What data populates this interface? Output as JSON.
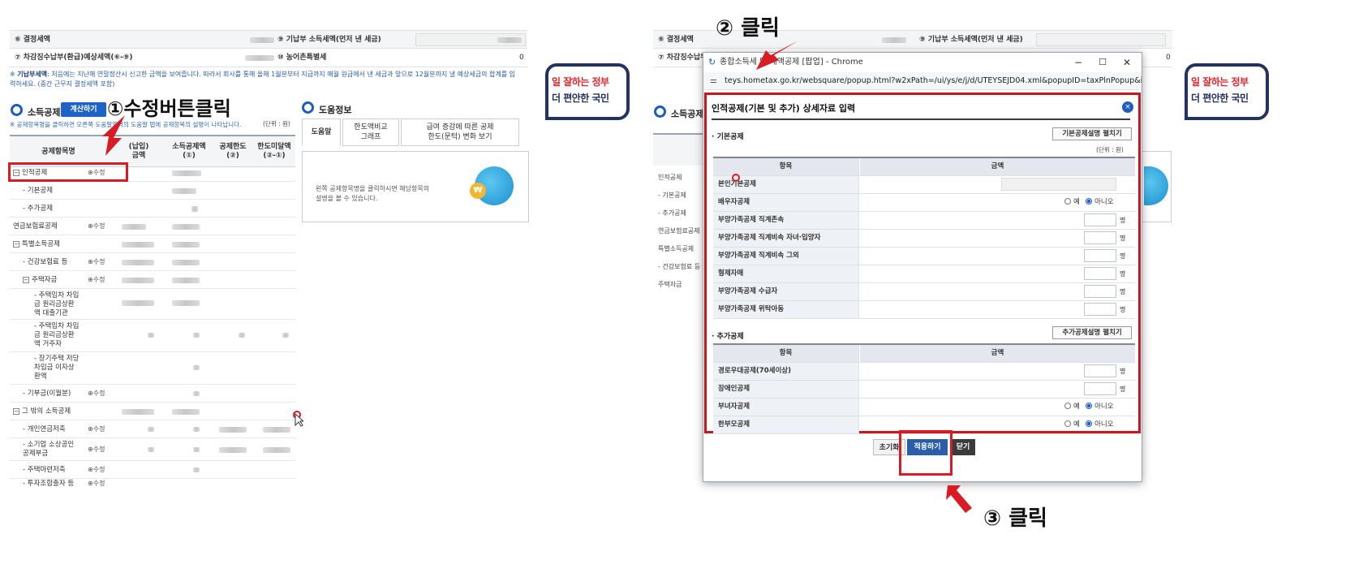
{
  "left_panel": {
    "summary": {
      "row1_left": "⑥ 결정세액",
      "row1_right": "⑨ 기납부 소득세액(먼저 낸 세금)",
      "row2_left": "⑦ 차감징수납부(환급)예상세액(⑥-⑨)",
      "row2_right": "⑩ 농어촌특별세",
      "row2_right_value": "0"
    },
    "note_label": "기납부세액",
    "note_text": ": 처음에는 지난해 연말정산시 신고한 금액을 보여줍니다. 따라서 회사를 통해 올해 1월분부터 지급까지 매월 원급에서 낸 세금과 앞으로 12월분까지 낼 예상세금의 합계를 입력하세요. (중간 근무지 결정세액 포함)",
    "section_title": "소득공제",
    "calc_button": "계산하기",
    "table_note": "※ 공제항목명을 클릭하면 오른쪽 도움말영역의 도움말 탭에 공제항목의 설명이 나타납니다.",
    "unit": "(단위 : 원)",
    "headers": [
      "공제항목명",
      "(납입)\n금액",
      "소득공제액\n(①)",
      "공제한도\n(②)",
      "한도미달액\n(②-①)"
    ],
    "rows": [
      {
        "label": "인적공제",
        "toggle": "−",
        "edit": "⊕수정"
      },
      {
        "label": "- 기본공제",
        "edit": ""
      },
      {
        "label": "- 추가공제",
        "edit": ""
      },
      {
        "label": "연금보험료공제",
        "edit": "⊕수정"
      },
      {
        "label": "특별소득공제",
        "toggle": "−",
        "edit": ""
      },
      {
        "label": "- 건강보험료 등",
        "edit": "⊕수정"
      },
      {
        "label": "주택자금",
        "toggle": "−",
        "edit": "⊕수정"
      },
      {
        "label": "- 주택임차 차입\n금 원리금상환\n액 대출기관",
        "edit": ""
      },
      {
        "label": "- 주택임차 차입\n금 원리금상환\n액 거주자",
        "edit": ""
      },
      {
        "label": "- 장기주택 저당\n차입금 이자상\n환액",
        "edit": ""
      },
      {
        "label": "- 기부금(이월분)",
        "edit": "⊕수정"
      },
      {
        "label": "그 밖의 소득공제",
        "toggle": "−",
        "edit": ""
      },
      {
        "label": "- 개인연금저축",
        "edit": "⊕수정"
      },
      {
        "label": "- 소기업 소상공인\n공제부금",
        "edit": "⊕수정"
      },
      {
        "label": "- 주택마련저축",
        "edit": "⊕수정"
      },
      {
        "label": "- 투자조합출자 등",
        "edit": "⊕수정"
      }
    ]
  },
  "help_panel": {
    "title": "도움정보",
    "tabs": [
      "도움말",
      "한도액비교\n그래프",
      "급여 증감에 따른 공제\n한도(문턱) 변화 보기"
    ],
    "message": "왼쪽 공제항목명을 클릭하시면 해당항목의\n설명을 볼 수 있습니다."
  },
  "gov_logo": {
    "line1": "일 잘하는 정부",
    "line2": "더 편안한 국민"
  },
  "annotations": {
    "step1": "①수정버튼클릭",
    "step2": "② 클릭",
    "step3": "③ 클릭"
  },
  "popup_window": {
    "title": "종합소득세 및 세액공제 [팝업] - Chrome",
    "url": "teys.hometax.go.kr/websquare/popup.html?w2xPath=/ui/ys/e/j/d/UTEYSEJD04.xml&popupID=taxPlnPopup&idx=..."
  },
  "modal": {
    "title": "인적공제(기본 및 추가) 상세자료 입력",
    "close_icon": "×",
    "unit": "(단위 : 원)",
    "basic": {
      "section": "기본공제",
      "expand_button": "기본공제설명 펼치기",
      "col_item": "항목",
      "col_amount": "금액",
      "rows": [
        {
          "label": "본인기본공제",
          "type": "readonly"
        },
        {
          "label": "배우자공제",
          "type": "radio",
          "opt1": "예",
          "opt2": "아니오"
        },
        {
          "label": "부양가족공제 직계존속",
          "type": "count",
          "unit": "명"
        },
        {
          "label": "부양가족공제 직계비속 자녀·입양자",
          "type": "count",
          "unit": "명"
        },
        {
          "label": "부양가족공제 직계비속 그외",
          "type": "count",
          "unit": "명"
        },
        {
          "label": "형제자매",
          "type": "count",
          "unit": "명"
        },
        {
          "label": "부양가족공제 수급자",
          "type": "count",
          "unit": "명"
        },
        {
          "label": "부양가족공제 위탁아동",
          "type": "count",
          "unit": "명"
        }
      ]
    },
    "additional": {
      "section": "추가공제",
      "expand_button": "추가공제설명 펼치기",
      "col_item": "항목",
      "col_amount": "금액",
      "rows": [
        {
          "label": "경로우대공제(70세이상)",
          "type": "count",
          "unit": "명"
        },
        {
          "label": "장애인공제",
          "type": "count",
          "unit": "명"
        },
        {
          "label": "부녀자공제",
          "type": "radio",
          "opt1": "예",
          "opt2": "아니오"
        },
        {
          "label": "한부모공제",
          "type": "radio",
          "opt1": "예",
          "opt2": "아니오"
        }
      ]
    },
    "buttons": {
      "reset": "초기화",
      "apply": "적용하기",
      "close": "닫기"
    }
  },
  "colors": {
    "annotation_red": "#d81c24",
    "primary_blue": "#1e64c8",
    "gov_navy": "#23325e"
  }
}
